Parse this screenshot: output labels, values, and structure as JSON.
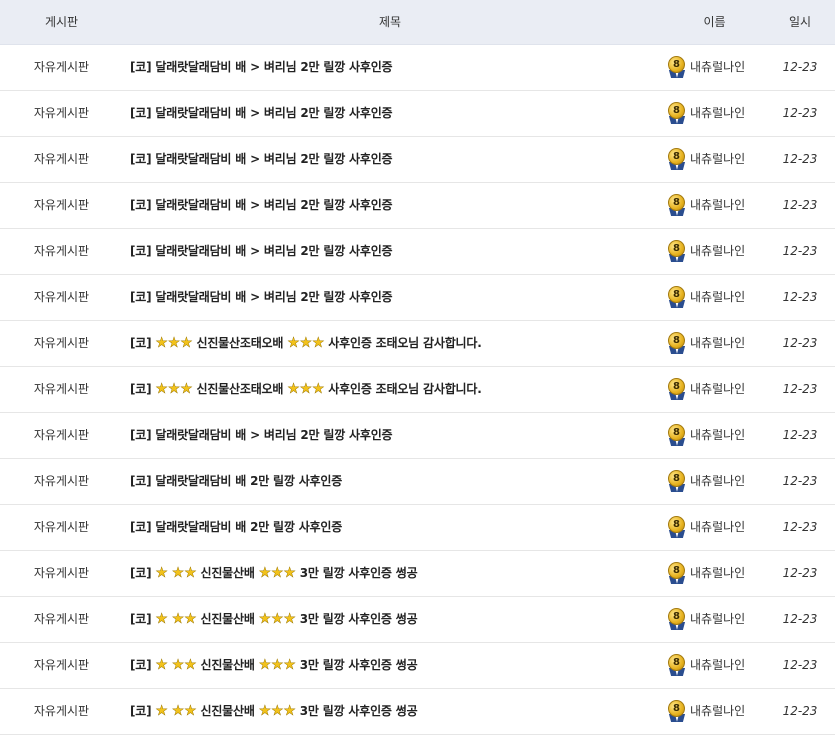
{
  "columns": {
    "board": "게시판",
    "title": "제목",
    "name": "이름",
    "date": "일시"
  },
  "badge_level": "8",
  "star_color": "#f2c21b",
  "rows": [
    {
      "board": "자유게시판",
      "title": "[코] 달래랏달래담비 배 > 벼리님 2만 릴깡 사후인증",
      "name": "내츄럴나인",
      "date": "12-23"
    },
    {
      "board": "자유게시판",
      "title": "[코] 달래랏달래담비 배 > 벼리님 2만 릴깡 사후인증",
      "name": "내츄럴나인",
      "date": "12-23"
    },
    {
      "board": "자유게시판",
      "title": "[코] 달래랏달래담비 배 > 벼리님 2만 릴깡 사후인증",
      "name": "내츄럴나인",
      "date": "12-23"
    },
    {
      "board": "자유게시판",
      "title": "[코] 달래랏달래담비 배 > 벼리님 2만 릴깡 사후인증",
      "name": "내츄럴나인",
      "date": "12-23"
    },
    {
      "board": "자유게시판",
      "title": "[코] 달래랏달래담비 배 > 벼리님 2만 릴깡 사후인증",
      "name": "내츄럴나인",
      "date": "12-23"
    },
    {
      "board": "자유게시판",
      "title": "[코] 달래랏달래담비 배 > 벼리님 2만 릴깡 사후인증",
      "name": "내츄럴나인",
      "date": "12-23"
    },
    {
      "board": "자유게시판",
      "title": "[코] ★★★ 신진물산조태오배 ★★★ 사후인증 조태오님 감사합니다.",
      "name": "내츄럴나인",
      "date": "12-23"
    },
    {
      "board": "자유게시판",
      "title": "[코] ★★★ 신진물산조태오배 ★★★ 사후인증 조태오님 감사합니다.",
      "name": "내츄럴나인",
      "date": "12-23"
    },
    {
      "board": "자유게시판",
      "title": "[코] 달래랏달래담비 배 > 벼리님 2만 릴깡 사후인증",
      "name": "내츄럴나인",
      "date": "12-23"
    },
    {
      "board": "자유게시판",
      "title": "[코] 달래랏달래담비 배 2만 릴깡 사후인증",
      "name": "내츄럴나인",
      "date": "12-23"
    },
    {
      "board": "자유게시판",
      "title": "[코] 달래랏달래담비 배 2만 릴깡 사후인증",
      "name": "내츄럴나인",
      "date": "12-23"
    },
    {
      "board": "자유게시판",
      "title": "[코] ★ ★★ 신진물산배 ★★★ 3만 릴깡 사후인증 썽공",
      "name": "내츄럴나인",
      "date": "12-23"
    },
    {
      "board": "자유게시판",
      "title": "[코] ★ ★★ 신진물산배 ★★★ 3만 릴깡 사후인증 썽공",
      "name": "내츄럴나인",
      "date": "12-23"
    },
    {
      "board": "자유게시판",
      "title": "[코] ★ ★★ 신진물산배 ★★★ 3만 릴깡 사후인증 썽공",
      "name": "내츄럴나인",
      "date": "12-23"
    },
    {
      "board": "자유게시판",
      "title": "[코] ★ ★★ 신진물산배 ★★★ 3만 릴깡 사후인증 썽공",
      "name": "내츄럴나인",
      "date": "12-23"
    }
  ]
}
